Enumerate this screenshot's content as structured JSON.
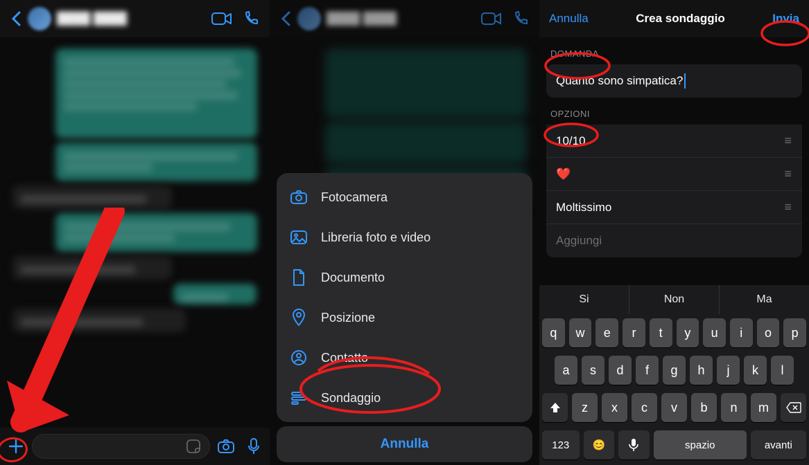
{
  "panel1": {
    "contact_name": "████ ████"
  },
  "panel2": {
    "sheet": {
      "camera": "Fotocamera",
      "library": "Libreria foto e video",
      "document": "Documento",
      "location": "Posizione",
      "contact": "Contatto",
      "poll": "Sondaggio",
      "cancel": "Annulla"
    }
  },
  "panel3": {
    "header": {
      "cancel": "Annulla",
      "title": "Crea sondaggio",
      "send": "Invia"
    },
    "question_label": "DOMANDA",
    "question_value": "Quanto sono simpatica?",
    "options_label": "OPZIONI",
    "options": [
      "10/10",
      "❤️",
      "Moltissimo"
    ],
    "add_placeholder": "Aggiungi",
    "suggest": [
      "Si",
      "Non",
      "Ma"
    ],
    "kbd_rows": {
      "r1": [
        "q",
        "w",
        "e",
        "r",
        "t",
        "y",
        "u",
        "i",
        "o",
        "p"
      ],
      "r2": [
        "a",
        "s",
        "d",
        "f",
        "g",
        "h",
        "j",
        "k",
        "l"
      ],
      "r3": [
        "z",
        "x",
        "c",
        "v",
        "b",
        "n",
        "m"
      ],
      "r4": {
        "num": "123",
        "emoji": "😊",
        "mic": "",
        "space": "spazio",
        "return": "avanti"
      }
    }
  }
}
